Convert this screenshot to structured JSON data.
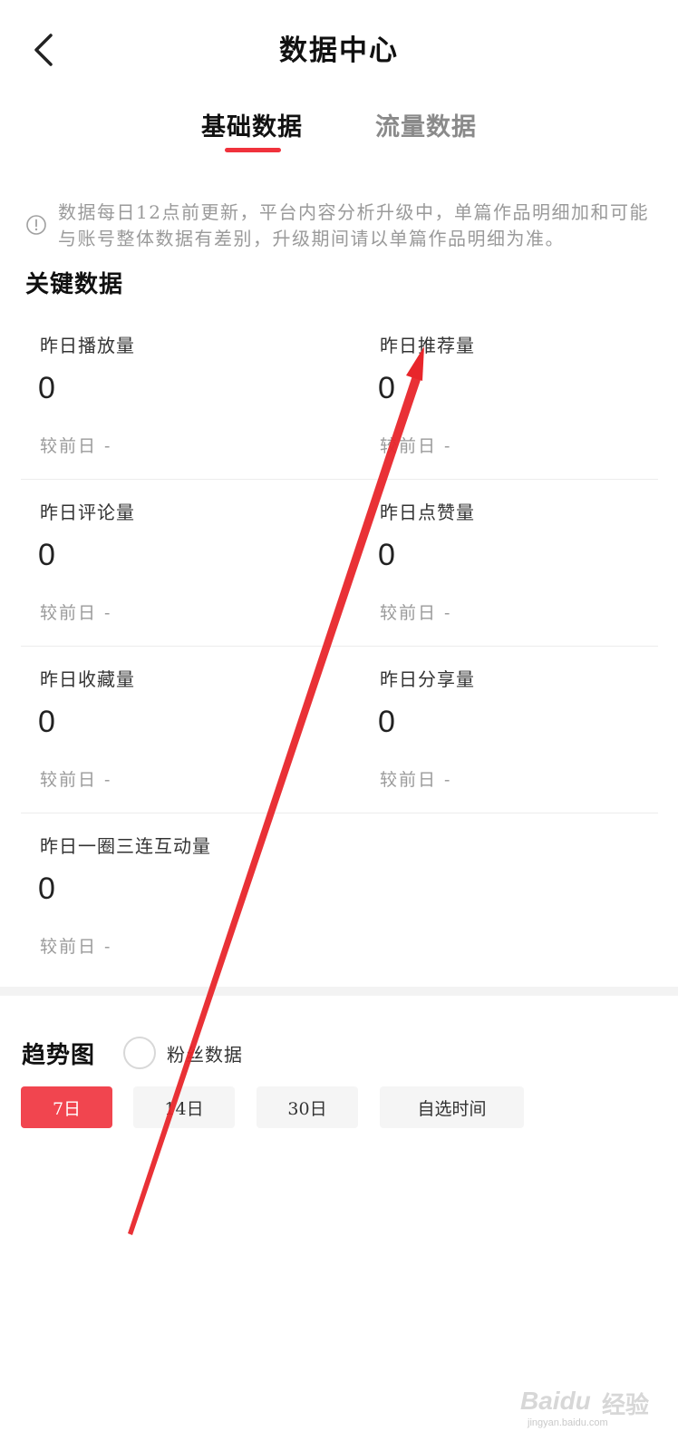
{
  "header": {
    "title": "数据中心",
    "back_icon": "chevron-left-icon"
  },
  "tabs": [
    {
      "label": "基础数据",
      "active": true
    },
    {
      "label": "流量数据",
      "active": false
    }
  ],
  "notice": {
    "icon": "info-circle-icon",
    "text": "数据每日12点前更新，平台内容分析升级中，单篇作品明细加和可能与账号整体数据有差别，升级期间请以单篇作品明细为准。"
  },
  "key_data": {
    "title": "关键数据",
    "metrics": [
      {
        "label": "昨日播放量",
        "value": "0",
        "compare": "较前日  -"
      },
      {
        "label": "昨日推荐量",
        "value": "0",
        "compare": "较前日  -"
      },
      {
        "label": "昨日评论量",
        "value": "0",
        "compare": "较前日  -"
      },
      {
        "label": "昨日点赞量",
        "value": "0",
        "compare": "较前日  -"
      },
      {
        "label": "昨日收藏量",
        "value": "0",
        "compare": "较前日  -"
      },
      {
        "label": "昨日分享量",
        "value": "0",
        "compare": "较前日  -"
      },
      {
        "label": "昨日一圈三连互动量",
        "value": "0",
        "compare": "较前日  -"
      }
    ]
  },
  "trend": {
    "title": "趋势图",
    "fans_toggle_label": "粉丝数据",
    "fans_toggle_checked": false,
    "ranges": [
      {
        "label": "7日",
        "active": true
      },
      {
        "label": "14日",
        "active": false
      },
      {
        "label": "30日",
        "active": false
      },
      {
        "label": "自选时间",
        "active": false
      }
    ]
  },
  "colors": {
    "accent": "#f0323c",
    "active_button": "#f1454f",
    "annotation_arrow": "#e8262b"
  },
  "watermark": {
    "brand": "Baidu",
    "product": "经验",
    "url": "jingyan.baidu.com"
  }
}
